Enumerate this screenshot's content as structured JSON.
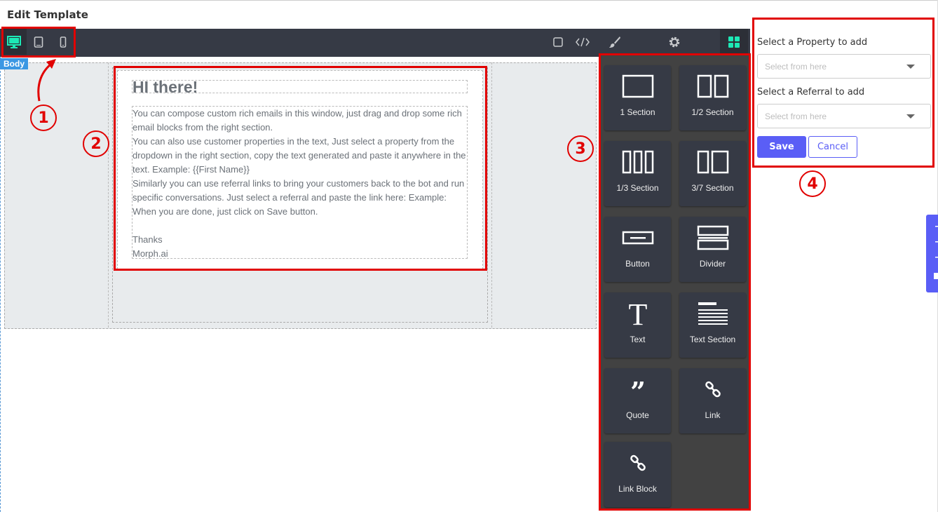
{
  "page": {
    "title": "Edit Template"
  },
  "email": {
    "heading": "HI there!",
    "lines": [
      "You can compose custom rich emails in this window, just drag and drop some rich",
      "email blocks from the right section.",
      "You can also use customer properties in the text, Just select a property from the",
      "dropdown in the right section, copy the text generated and paste it anywhere in the",
      "text. Example: {{First Name}}",
      "Similarly you can use referral links to bring your customers back to the bot and run",
      "specific conversations. Just select a referral and paste the link here: Example:",
      "When you are done, just click on Save button.",
      "",
      "Thanks",
      "Morph.ai"
    ]
  },
  "canvas": {
    "body_tag": "Body"
  },
  "blocks": [
    {
      "label": "1 Section",
      "icon": "one-section-icon"
    },
    {
      "label": "1/2 Section",
      "icon": "half-section-icon"
    },
    {
      "label": "1/3 Section",
      "icon": "third-section-icon"
    },
    {
      "label": "3/7 Section",
      "icon": "three-seven-section-icon"
    },
    {
      "label": "Button",
      "icon": "button-block-icon"
    },
    {
      "label": "Divider",
      "icon": "divider-block-icon"
    },
    {
      "label": "Text",
      "icon": "text-block-icon"
    },
    {
      "label": "Text Section",
      "icon": "text-section-icon"
    },
    {
      "label": "Quote",
      "icon": "quote-icon"
    },
    {
      "label": "Link",
      "icon": "link-icon"
    },
    {
      "label": "Link Block",
      "icon": "link-block-icon"
    }
  ],
  "form": {
    "property_label": "Select a Property to add",
    "property_placeholder": "Select from here",
    "referral_label": "Select a Referral to add",
    "referral_placeholder": "Select from here",
    "save_label": "Save",
    "cancel_label": "Cancel"
  },
  "annotations": {
    "one": "1",
    "two": "2",
    "three": "3",
    "four": "4"
  },
  "colors": {
    "toolbar": "#363a45",
    "accent": "#5a5ef6",
    "annotation": "#e10000",
    "active_icon": "#1de9b6"
  }
}
